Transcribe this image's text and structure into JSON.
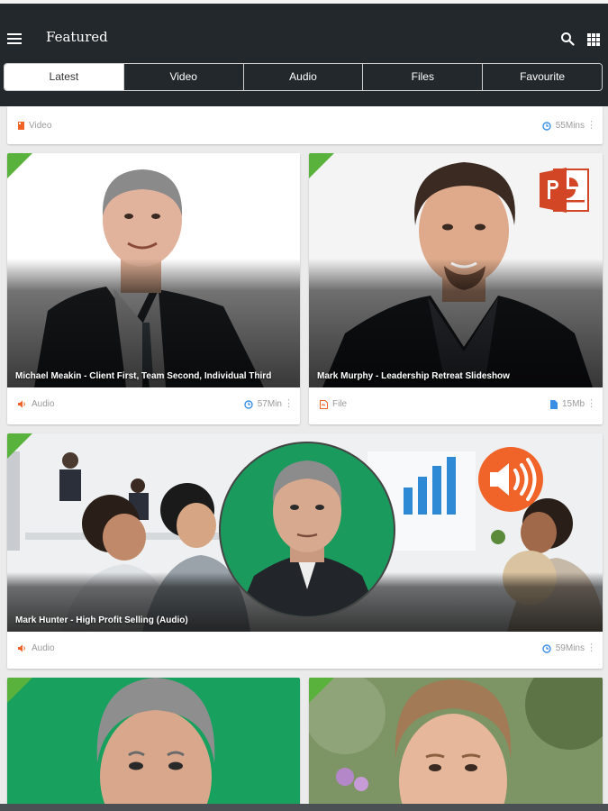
{
  "header": {
    "title": "Featured",
    "menu_icon": "menu-icon",
    "search_icon": "search-icon",
    "apps_icon": "grid-icon"
  },
  "tabs": [
    {
      "label": "Latest",
      "active": true
    },
    {
      "label": "Video",
      "active": false
    },
    {
      "label": "Audio",
      "active": false
    },
    {
      "label": "Files",
      "active": false
    },
    {
      "label": "Favourite",
      "active": false
    }
  ],
  "cards": [
    {
      "caption": "",
      "type": "Video",
      "type_icon": "video-icon",
      "meta": "55Mins",
      "meta_icon": "clock-icon"
    },
    {
      "caption": "Michael Meakin - Client First, Team Second, Individual Third",
      "type": "Audio",
      "type_icon": "speaker-icon",
      "meta": "57Min",
      "meta_icon": "clock-icon"
    },
    {
      "caption": "Mark Murphy - Leadership Retreat Slideshow",
      "type": "File",
      "type_icon": "file-icon",
      "meta": "15Mb",
      "meta_icon": "document-icon"
    },
    {
      "caption": "Mark Hunter - High Profit Selling (Audio)",
      "type": "Audio",
      "type_icon": "speaker-icon",
      "meta": "59Mins",
      "meta_icon": "clock-icon"
    },
    {
      "caption": "",
      "type": "",
      "meta": ""
    },
    {
      "caption": "",
      "type": "",
      "meta": ""
    }
  ],
  "colors": {
    "topbar": "#23282c",
    "accent_green": "#59b23b",
    "clock_blue": "#3a8ee6",
    "audio_orange": "#f0642a"
  }
}
